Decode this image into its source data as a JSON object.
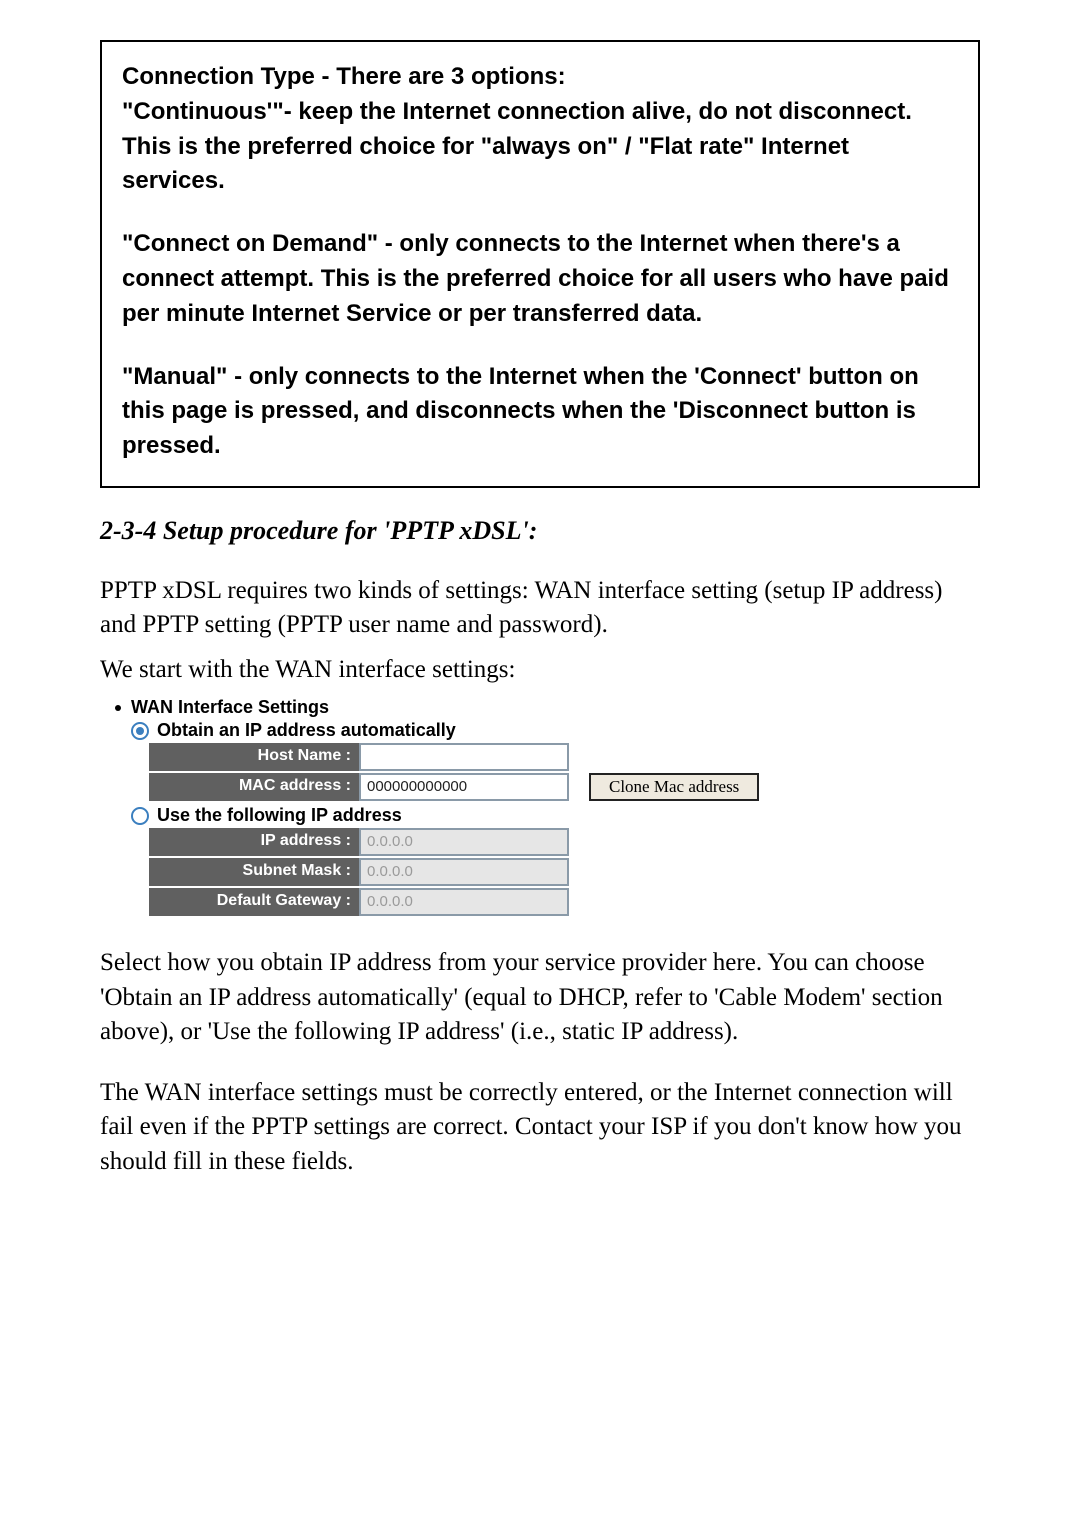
{
  "box": {
    "p1": "Connection Type - There are 3 options:",
    "p1b": "\"Continuous'\"- keep the Internet connection alive, do not disconnect. This is the preferred choice for \"always on\" / \"Flat rate\" Internet services.",
    "p2": "\"Connect on Demand\" - only connects to the Internet when there's a connect attempt. This is the preferred choice for all users who have paid per minute Internet Service or per transferred data.",
    "p3": "\"Manual\" - only connects to the Internet when the 'Connect' button on this page is pressed, and disconnects when the 'Disconnect button is pressed."
  },
  "heading": "2-3-4 Setup procedure for 'PPTP xDSL':",
  "intro1": "PPTP xDSL requires two kinds of settings: WAN interface setting (setup IP address) and PPTP setting (PPTP user name and password).",
  "intro2": "We start with the WAN interface settings:",
  "wan": {
    "title": "WAN Interface Settings",
    "opt_auto": "Obtain an IP address automatically",
    "opt_static": "Use the following IP address",
    "host_label": "Host Name :",
    "host_value": "",
    "mac_label": "MAC address :",
    "mac_value": "000000000000",
    "clone_btn": "Clone Mac address",
    "ip_label": "IP address :",
    "ip_value": "0.0.0.0",
    "mask_label": "Subnet Mask :",
    "mask_value": "0.0.0.0",
    "gw_label": "Default Gateway :",
    "gw_value": "0.0.0.0"
  },
  "para_after1": "Select how you obtain IP address from your service provider here. You can choose 'Obtain an IP address automatically' (equal to DHCP, refer to 'Cable Modem' section above), or 'Use the following IP address' (i.e., static IP address).",
  "para_after2": "The WAN interface settings must be correctly entered, or the Internet connection will fail even if the PPTP settings are correct. Contact your ISP if you don't know how you should fill in these fields."
}
